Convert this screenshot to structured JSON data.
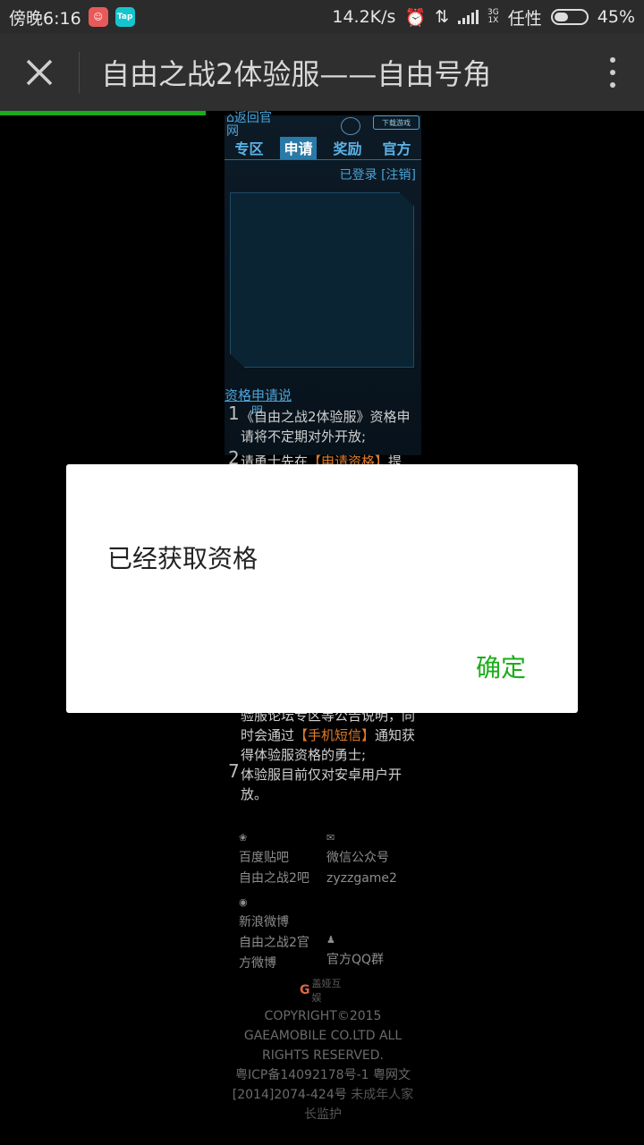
{
  "status_bar": {
    "time": "傍晚6:16",
    "net_speed": "14.2K/s",
    "net_type_top": "3G",
    "net_type_bottom": "1X",
    "carrier": "任性",
    "battery": "45%",
    "battery_level": 0.45
  },
  "title_bar": {
    "title": "自由之战2体验服——自由号角"
  },
  "load_progress": 0.32,
  "site": {
    "back_link": "返回官网",
    "download_label": "下载游戏",
    "tabs": [
      "专区",
      "申请",
      "奖励",
      "官方"
    ],
    "active_tab": 1,
    "login_status": "已登录 [注销]",
    "section_title": "资格申请说",
    "section_title_2": "明",
    "items": [
      {
        "num": "1",
        "text_before": "《自由之战2体验服》资格申请将不定期对外开放;",
        "highlight": "",
        "text_after": ""
      },
      {
        "num": "2",
        "text_before": "请勇士先在",
        "highlight": "【申请资格】",
        "text_after": "提"
      },
      {
        "num": "",
        "text_before": "验服论坛专区等公告说明，同时会通过",
        "highlight": "【手机短信】",
        "text_after": "通知获得体验服资格的勇士;"
      },
      {
        "num": "7",
        "text_before": "体验服目前仅对安卓用户开放。",
        "highlight": "",
        "text_after": ""
      }
    ],
    "links": {
      "tieba_label": "百度贴吧",
      "tieba_name": "自由之战2吧",
      "wechat_label": "微信公众号",
      "wechat_name": "zyzzgame2",
      "weibo_label": "新浪微博",
      "weibo_name_1": "自由之战2官",
      "weibo_name_2": "方微博",
      "qq_label": "官方QQ群"
    },
    "copyright_lines": [
      "COPYRIGHT©2015",
      "GAEAMOBILE CO.LTD ALL",
      "RIGHTS RESERVED.",
      "粤ICP备14092178号-1 粤网文",
      "[2014]2074-424号"
    ],
    "minor_notice_1": "未成年人家",
    "minor_notice_2": "长监护",
    "publisher_logo_text": "盖娅互娱"
  },
  "dialog": {
    "message": "已经获取资格",
    "ok_label": "确定"
  },
  "colors": {
    "accent_green": "#1aad19",
    "link_blue": "#4ba3d6",
    "highlight_orange": "#e07b2a"
  }
}
